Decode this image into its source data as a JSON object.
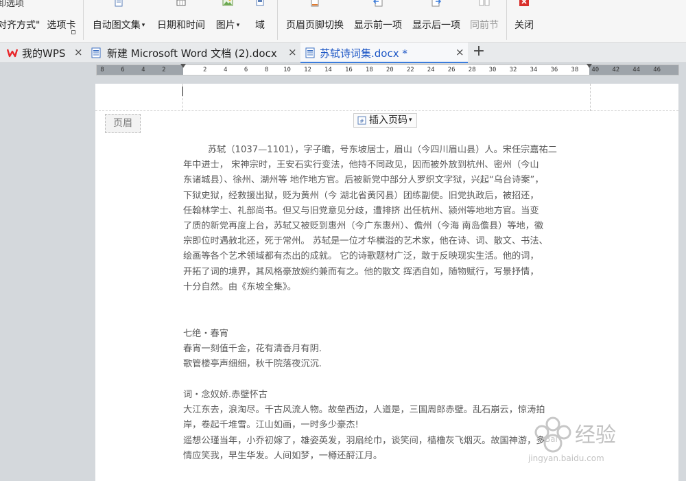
{
  "ribbon": {
    "top_fragment": "卸选项",
    "left_fragment_1": "对齐方式\"",
    "left_fragment_2": "选项卡",
    "buttons": [
      {
        "label": "自动图文集",
        "caret": "▾"
      },
      {
        "label": "日期和时间"
      },
      {
        "label": "图片",
        "caret": "▾"
      },
      {
        "label": "域"
      },
      {
        "label": "页眉页脚切换"
      },
      {
        "label": "显示前一项"
      },
      {
        "label": "显示后一项"
      },
      {
        "label": "同前节",
        "disabled": true
      },
      {
        "label": "关闭"
      }
    ]
  },
  "tabs": [
    {
      "label": "我的WPS",
      "close": "×"
    },
    {
      "label": "新建 Microsoft Word 文档 (2).docx",
      "close": "×"
    },
    {
      "label": "苏轼诗词集.docx *",
      "close": "×",
      "active": true
    }
  ],
  "new_tab": "+",
  "ruler": {
    "ticks": [
      "8",
      "6",
      "4",
      "2",
      "",
      "2",
      "4",
      "6",
      "8",
      "10",
      "12",
      "14",
      "16",
      "18",
      "20",
      "22",
      "24",
      "26",
      "28",
      "30",
      "32",
      "34",
      "36",
      "38",
      "40",
      "42",
      "44",
      "46"
    ]
  },
  "document": {
    "header_label": "页眉",
    "insert_page_number": "插入页码",
    "insert_page_number_caret": "▾",
    "bio_lines": [
      "苏轼（1037—1101），字子瞻，号东坡居士，眉山（今四川眉山县）人。宋任宗嘉祐二",
      "年中进士， 宋神宗时，王安石实行变法，他持不同政见，因而被外放到杭州、密州（今山",
      "东诸城县）、徐州、湖州等 地作地方官。后被新党中部分人罗织文字狱，兴起“乌台诗案”，",
      "下狱史狱，经救援出狱，贬为黄州（今 湖北省黄冈县）团练副使。旧党执政后，被招还，",
      "任翰林学士、礼部尚书。但又与旧党意见分歧，遭排挤 出任杭州、颍州等地地方官。当变",
      "了质的新党再度上台，苏轼又被贬到惠州（今广东惠州）、儋州（今海 南岛儋县）等地，徽",
      "宗即位时遇赦北还，死于常州。 苏轼是一位才华横溢的艺术家，他在诗、词、散文、书法、",
      "绘画等各个艺术领域都有杰出的成就。 它的诗歌题材广泛，敢于反映现实生活。他的词，",
      "开拓了词的境界，其风格豪放婉约兼而有之。他的散文 挥洒自如，随物赋行，写景抒情，",
      "十分自然。由《东坡全集》。"
    ],
    "poem1": {
      "title": "七绝・春宵",
      "lines": [
        "春宵一刻值千金，花有清香月有阴.",
        "歌管楼亭声细细，秋千院落夜沉沉."
      ]
    },
    "poem2": {
      "title": "词・念奴娇.赤壁怀古",
      "lines": [
        "大江东去，浪淘尽。千古风流人物。故垒西边，人道是，三国周郎赤壁。乱石崩云，惊涛拍",
        "岸，卷起千堆雪。江山如画，一时多少豪杰!",
        "遥想公瑾当年，小乔初嫁了，雄姿英发，羽扇纶巾，谈笑间，樯橹灰飞烟灭。故国神游，多",
        "情应笑我，早生华发。人间如梦，一樽还酹江月。"
      ]
    }
  },
  "watermark": {
    "brand": "Bai",
    "text": "经验",
    "url": "jingyan.baidu.com"
  },
  "colors": {
    "accent": "#3b7ddd",
    "wps_red": "#e8262a",
    "close_red": "#d9302c"
  }
}
